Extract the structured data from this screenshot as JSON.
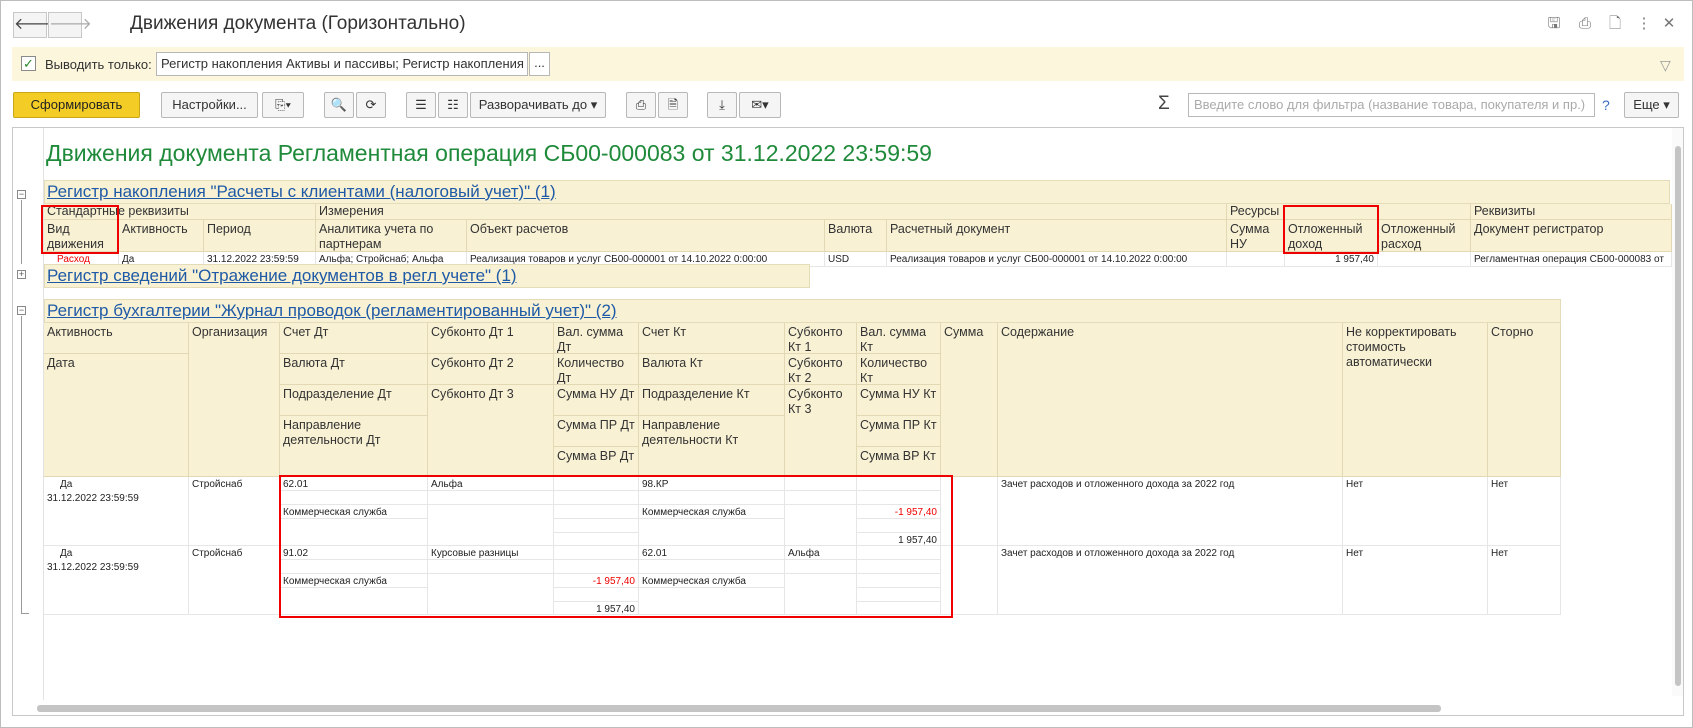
{
  "window": {
    "title": "Движения документа (Горизонтально)",
    "back_icon": "arrow-left",
    "forward_icon": "arrow-right"
  },
  "filter": {
    "label": "Выводить только:",
    "value": "Регистр накопления Активы и пассивы; Регистр накопления Дви",
    "more": "..."
  },
  "toolbar": {
    "generate": "Сформировать",
    "settings": "Настройки...",
    "expand_to": "Разворачивать до",
    "search_placeholder": "Введите слово для фильтра (название товара, покупателя и пр.)",
    "sigma": "Σ",
    "help": "?",
    "more": "Еще"
  },
  "report": {
    "title": "Движения документа Регламентная операция СБ00-000083 от 31.12.2022 23:59:59",
    "section1": {
      "title": "Регистр накопления \"Расчеты с клиентами (налоговый учет)\" (1)",
      "groups": {
        "standard": "Стандартные реквизиты",
        "dimensions": "Измерения",
        "resources": "Ресурсы",
        "attributes": "Реквизиты"
      },
      "columns": {
        "kind": "Вид движения",
        "activity": "Активность",
        "period": "Период",
        "analytics": "Аналитика учета по партнерам",
        "object": "Объект расчетов",
        "currency": "Валюта",
        "settlement_doc": "Расчетный документ",
        "sum_nu": "Сумма НУ",
        "deferred_income": "Отложенный доход",
        "deferred_expense": "Отложенный расход",
        "registrar": "Документ регистратор"
      },
      "row": {
        "kind": "Расход",
        "activity": "Да",
        "period": "31.12.2022 23:59:59",
        "analytics": "Альфа; Стройснаб; Альфа",
        "object": "Реализация товаров и услуг СБ00-000001 от 14.10.2022 0:00:00",
        "currency": "USD",
        "settlement_doc": "Реализация товаров и услуг СБ00-000001 от 14.10.2022 0:00:00",
        "sum_nu": "",
        "deferred_income": "1 957,40",
        "deferred_expense": "",
        "registrar": "Регламентная операция СБ00-000083 от"
      }
    },
    "section2": {
      "title": "Регистр сведений \"Отражение документов в регл учете\" (1)"
    },
    "section3": {
      "title": "Регистр бухгалтерии \"Журнал проводок (регламентированный учет)\" (2)",
      "headers": {
        "activity": "Активность",
        "date": "Дата",
        "org": "Организация",
        "acc_dt": "Счет Дт",
        "cur_dt": "Валюта Дт",
        "dep_dt": "Подразделение Дт",
        "dir_dt": "Направление деятельности Дт",
        "sub_dt1": "Субконто Дт 1",
        "sub_dt2": "Субконто Дт 2",
        "sub_dt3": "Субконто Дт 3",
        "vsum_dt": "Вал. сумма Дт",
        "qty_dt": "Количество Дт",
        "nu_dt": "Сумма НУ Дт",
        "pr_dt": "Сумма ПР Дт",
        "vr_dt": "Сумма ВР Дт",
        "acc_kt": "Счет Кт",
        "cur_kt": "Валюта Кт",
        "dep_kt": "Подразделение Кт",
        "dir_kt": "Направление деятельности Кт",
        "sub_kt1": "Субконто Кт 1",
        "sub_kt2": "Субконто Кт 2",
        "sub_kt3": "Субконто Кт 3",
        "vsum_kt": "Вал. сумма Кт",
        "qty_kt": "Количество Кт",
        "nu_kt": "Сумма НУ Кт",
        "pr_kt": "Сумма ПР Кт",
        "vr_kt": "Сумма ВР Кт",
        "sum": "Сумма",
        "content": "Содержание",
        "no_adjust": "Не корректировать стоимость автоматически",
        "storno": "Сторно"
      },
      "rows": [
        {
          "activity": "Да",
          "date": "31.12.2022 23:59:59",
          "org": "Стройснаб",
          "acc_dt": "62.01",
          "sub_dt1": "Альфа",
          "dep_dt": "Коммерческая служба",
          "nu_dt": "",
          "vr_dt": "",
          "acc_kt": "98.КР",
          "dep_kt": "Коммерческая служба",
          "sub_kt1": "",
          "nu_kt": "-1 957,40",
          "vr_kt": "1 957,40",
          "content": "Зачет расходов и отложенного дохода за 2022 год",
          "no_adjust": "Нет",
          "storno": "Нет"
        },
        {
          "activity": "Да",
          "date": "31.12.2022 23:59:59",
          "org": "Стройснаб",
          "acc_dt": "91.02",
          "sub_dt1": "Курсовые разницы",
          "dep_dt": "Коммерческая служба",
          "nu_dt": "-1 957,40",
          "vr_dt": "1 957,40",
          "acc_kt": "62.01",
          "dep_kt": "Коммерческая служба",
          "sub_kt1": "Альфа",
          "nu_kt": "",
          "vr_kt": "",
          "content": "Зачет расходов и отложенного дохода за 2022 год",
          "no_adjust": "Нет",
          "storno": "Нет"
        }
      ]
    }
  },
  "colors": {
    "accent_yellow": "#f3cc26",
    "title_green": "#1f8a3a",
    "link_blue": "#1f5aa6",
    "highlight_red": "#e00000"
  }
}
